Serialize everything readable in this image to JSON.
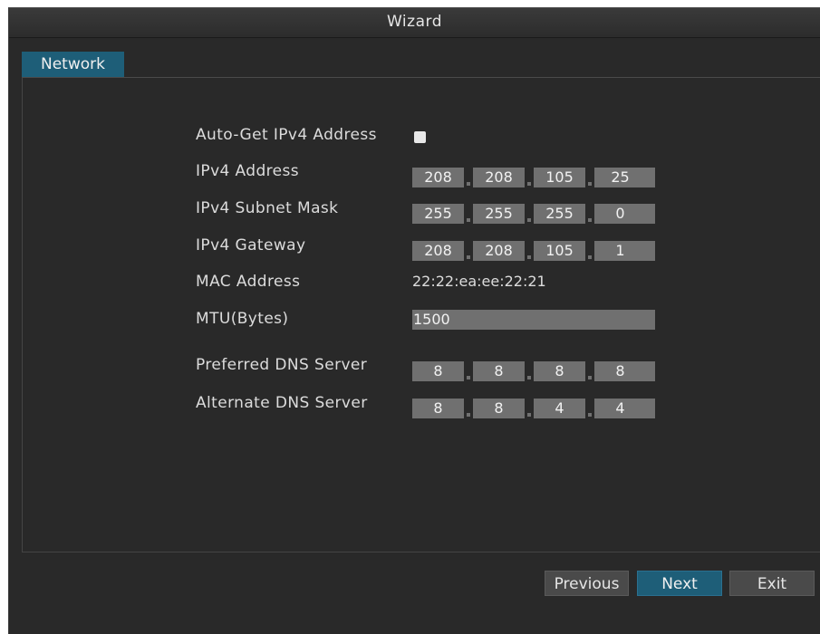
{
  "window": {
    "title": "Wizard"
  },
  "tabs": [
    {
      "label": "Network",
      "active": true
    }
  ],
  "form": {
    "auto_get": {
      "label": "Auto-Get IPv4 Address",
      "checked": false
    },
    "ipv4_address": {
      "label": "IPv4 Address",
      "octets": [
        "208",
        "208",
        "105",
        "25"
      ]
    },
    "subnet_mask": {
      "label": "IPv4 Subnet Mask",
      "octets": [
        "255",
        "255",
        "255",
        "0"
      ]
    },
    "gateway": {
      "label": "IPv4 Gateway",
      "octets": [
        "208",
        "208",
        "105",
        "1"
      ]
    },
    "mac": {
      "label": "MAC Address",
      "value": "22:22:ea:ee:22:21"
    },
    "mtu": {
      "label": "MTU(Bytes)",
      "value": "1500"
    },
    "preferred_dns": {
      "label": "Preferred DNS Server",
      "octets": [
        "8",
        "8",
        "8",
        "8"
      ]
    },
    "alternate_dns": {
      "label": "Alternate DNS Server",
      "octets": [
        "8",
        "8",
        "4",
        "4"
      ]
    }
  },
  "buttons": {
    "previous": "Previous",
    "next": "Next",
    "exit": "Exit"
  },
  "colors": {
    "accent": "#1e5e78",
    "background": "#292929",
    "field": "#707070"
  }
}
